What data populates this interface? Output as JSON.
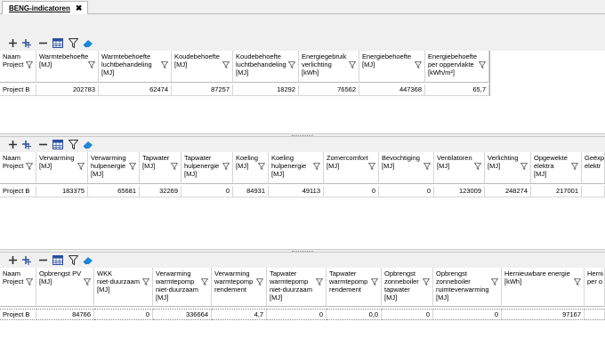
{
  "tab": {
    "label": "BENG-indicatoren",
    "close": "✖"
  },
  "toolbar_icons": [
    "add-icon",
    "add-sub-icon",
    "remove-icon",
    "table-icon",
    "filter-icon",
    "eraser-icon"
  ],
  "panel1": {
    "headers": [
      "Naam\nProject",
      "Warmtebehoefte\n[MJ]",
      "Warmtebehoefte\nluchtbehandeling\n[MJ]",
      "Koudebehoefte\n[MJ]",
      "Koudebehoefte\nluchtbehandeling\n[MJ]",
      "Energiegebruik\nverlichting\n[kWh]",
      "Energiebehoefte\n[MJ]",
      "Energiebehoefte\nper oppervlakte\n[kWh/m²]"
    ],
    "row": [
      "Project B",
      "202783",
      "62474",
      "87257",
      "18292",
      "76562",
      "447368",
      "65,7"
    ]
  },
  "panel2": {
    "headers": [
      "Naam\nProject",
      "Verwarming\n[MJ]",
      "Verwarming\nhulpenergie\n[MJ]",
      "Tapwater\n[MJ]",
      "Tapwater\nhulpenergie\n[MJ]",
      "Koeling\n[MJ]",
      "Koeling\nhulpenergie\n[MJ]",
      "Zomercomfort\n[MJ]",
      "Bevochtiging\n[MJ]",
      "Ventilatoren\n[MJ]",
      "Verlichting\n[MJ]",
      "Opgewekte\nelektra\n[MJ]",
      "Geëxp\nelektr"
    ],
    "row": [
      "Project B",
      "183375",
      "65681",
      "32269",
      "0",
      "84931",
      "49113",
      "0",
      "0",
      "123009",
      "248274",
      "217001",
      ""
    ]
  },
  "panel3": {
    "headers": [
      "Naam\nProject",
      "Opbrengst PV\n[MJ]",
      "WKK\nniet-duurzaam\n[MJ]",
      "Verwarming\nwarmtepomp\nniet-duurzaam\n[MJ]",
      "Verwarming\nwarmtepomp\nrendement",
      "Tapwater\nwarmtepomp\nniet-duurzaam\n[MJ]",
      "Tapwater\nwarmtepomp\nrendement",
      "Opbrengst\nzonneboiler\ntapwater\n[MJ]",
      "Opbrengst\nzonneboiler\nruimteverwarming\n[MJ]",
      "Hernieuwbare energie\n[kWh]",
      "Herni\nper o"
    ],
    "row": [
      "Project B",
      "84766",
      "0",
      "336664",
      "4,7",
      "0",
      "0,0",
      "0",
      "0",
      "97167",
      ""
    ]
  }
}
